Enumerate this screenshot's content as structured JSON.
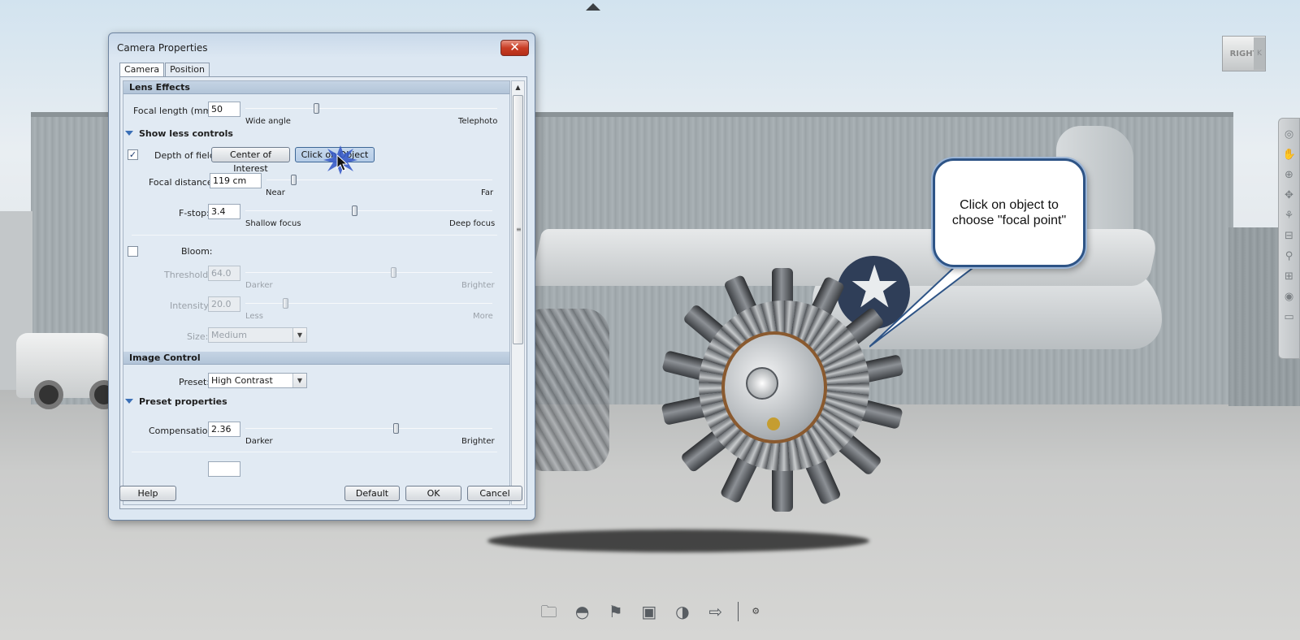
{
  "dialog": {
    "title": "Camera Properties",
    "close_glyph": "✕",
    "tabs": [
      {
        "label": "Camera",
        "active": true
      },
      {
        "label": "Position",
        "active": false
      }
    ],
    "lens_effects": {
      "header": "Lens Effects",
      "focal_length": {
        "label": "Focal length (mm):",
        "value": "50",
        "min_label": "Wide angle",
        "max_label": "Telephoto",
        "position": 0.28
      },
      "toggle_controls": "Show less controls",
      "depth_of_field": {
        "label": "Depth of field:",
        "checked": true,
        "btn_center": "Center of Interest",
        "btn_click_object": "Click on Object"
      },
      "focal_distance": {
        "label": "Focal distance:",
        "value": "119 cm",
        "min_label": "Near",
        "max_label": "Far",
        "position": 0.12
      },
      "fstop": {
        "label": "F-stop:",
        "value": "3.4",
        "min_label": "Shallow focus",
        "max_label": "Deep focus",
        "position": 0.44
      },
      "bloom": {
        "label": "Bloom:",
        "checked": false
      },
      "threshold": {
        "label": "Threshold:",
        "value": "64.0",
        "min_label": "Darker",
        "max_label": "Brighter",
        "position": 0.6
      },
      "intensity": {
        "label": "Intensity:",
        "value": "20.0",
        "min_label": "Less",
        "max_label": "More",
        "position": 0.16
      },
      "size": {
        "label": "Size:",
        "value": "Medium"
      }
    },
    "image_control": {
      "header": "Image Control",
      "preset": {
        "label": "Preset:",
        "value": "High Contrast"
      },
      "preset_properties": "Preset properties",
      "compensation": {
        "label": "Compensation:",
        "value": "2.36",
        "min_label": "Darker",
        "max_label": "Brighter",
        "position": 0.61
      }
    },
    "buttons": {
      "help": "Help",
      "default": "Default",
      "ok": "OK",
      "cancel": "Cancel"
    }
  },
  "callout": {
    "line1": "Click on object to",
    "line2": "choose \"focal point\""
  },
  "viewcube": {
    "face": "RIGHT",
    "side": "K"
  },
  "icons": {
    "top_arrow": "up-triangle-icon",
    "right_toolbar": [
      "steering-wheel-icon",
      "pan-hand-icon",
      "zoom-icon",
      "orbit-icon",
      "look-icon",
      "walk-icon",
      "camera-icon",
      "center-icon",
      "rewind-icon",
      "settings-icon"
    ],
    "bottom_toolbar": [
      "open-folder-icon",
      "environment-dome-icon",
      "lighting-icon",
      "camera-icon",
      "material-icon",
      "export-icon",
      "small-settings-icon"
    ]
  },
  "colors": {
    "callout_border": "#2e5486",
    "close_button": "#c83d25",
    "dialog_bg": "#dce7f2"
  }
}
